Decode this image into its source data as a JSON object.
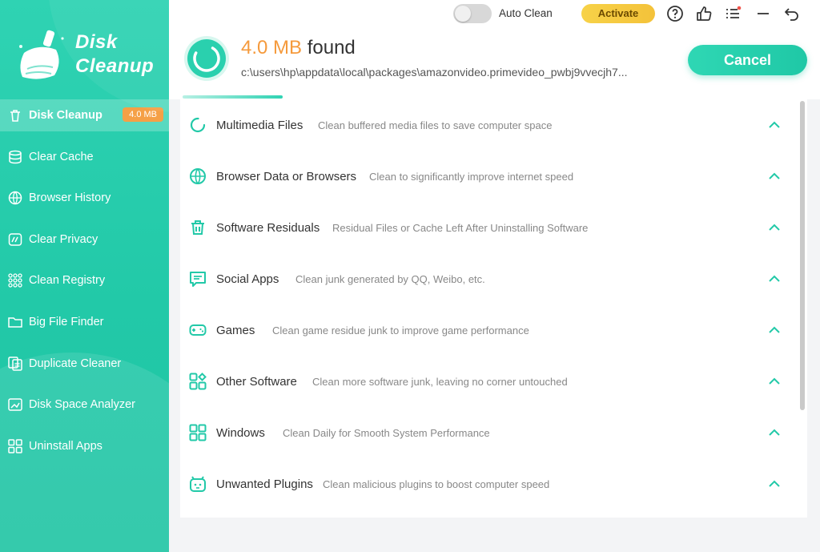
{
  "app": {
    "brand_line1": "Disk",
    "brand_line2": "Cleanup"
  },
  "colors": {
    "accent": "#22c9a8",
    "badge": "#f5a046",
    "found_size": "#f59a3c",
    "activate": "#f4c23a"
  },
  "sidebar": {
    "items": [
      {
        "label": "Disk Cleanup",
        "icon": "trash-icon",
        "badge": "4.0 MB",
        "active": true
      },
      {
        "label": "Clear Cache",
        "icon": "database-icon"
      },
      {
        "label": "Browser History",
        "icon": "globe-icon"
      },
      {
        "label": "Clear Privacy",
        "icon": "privacy-icon"
      },
      {
        "label": "Clean Registry",
        "icon": "grid-dots-icon"
      },
      {
        "label": "Big File Finder",
        "icon": "folder-icon"
      },
      {
        "label": "Duplicate Cleaner",
        "icon": "duplicate-icon"
      },
      {
        "label": "Disk Space Analyzer",
        "icon": "disk-analyzer-icon"
      },
      {
        "label": "Uninstall Apps",
        "icon": "apps-icon"
      }
    ]
  },
  "topbar": {
    "auto_clean_label": "Auto Clean",
    "auto_clean_on": false,
    "activate_label": "Activate",
    "icons": [
      "help-icon",
      "thumbs-up-icon",
      "menu-icon",
      "minimize-icon",
      "back-icon"
    ]
  },
  "header": {
    "found_size": "4.0 MB",
    "found_label": "found",
    "scan_path": "c:\\users\\hp\\appdata\\local\\packages\\amazonvideo.primevideo_pwbj9vvecjh7...",
    "cancel_label": "Cancel",
    "progress": 0.16
  },
  "categories": [
    {
      "name": "Multimedia Files",
      "desc": "Clean buffered media files to save computer space",
      "icon": "spinner-icon"
    },
    {
      "name": "Browser Data or Browsers",
      "desc": "Clean to significantly improve internet speed",
      "icon": "globe-icon"
    },
    {
      "name": "Software Residuals",
      "desc": "Residual Files or Cache Left After Uninstalling Software",
      "icon": "trash-icon"
    },
    {
      "name": "Social Apps",
      "desc": "Clean junk generated by QQ, Weibo, etc.",
      "icon": "chat-icon"
    },
    {
      "name": "Games",
      "desc": "Clean game residue junk to improve game performance",
      "icon": "gamepad-icon"
    },
    {
      "name": "Other Software",
      "desc": "Clean more software junk, leaving no corner untouched",
      "icon": "apps-icon"
    },
    {
      "name": "Windows",
      "desc": "Clean Daily for Smooth System Performance",
      "icon": "windows-icon"
    },
    {
      "name": "Unwanted Plugins",
      "desc": "Clean malicious plugins to boost computer speed",
      "icon": "plugin-icon"
    }
  ]
}
